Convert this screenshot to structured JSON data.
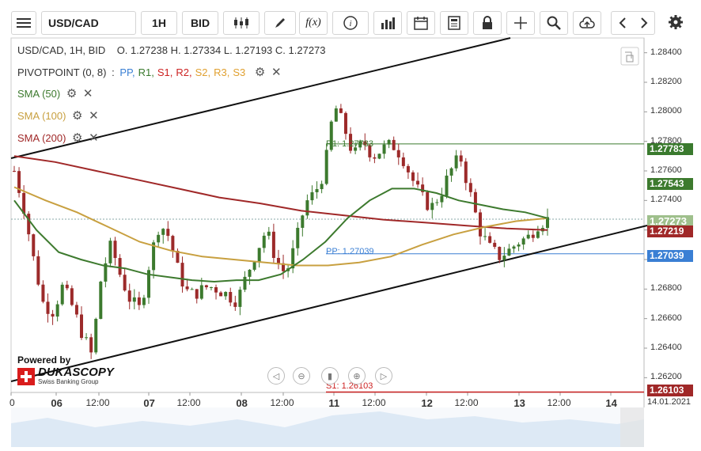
{
  "toolbar": {
    "menu_icon": "hamburger-icon",
    "symbol": "USD/CAD",
    "timeframe": "1H",
    "price_type": "BID",
    "fx_label": "f(x)",
    "info_label": "i"
  },
  "header": {
    "ohlc": "USD/CAD, 1H, BID    O. 1.27238 H. 1.27334 L. 1.27193 C. 1.27273"
  },
  "legend": {
    "pivot": {
      "name": "PIVOTPOINT (0, 8)",
      "sep": ":",
      "items": [
        "PP,",
        "R1,",
        "S1,",
        "R2,",
        "S2,",
        "R3,",
        "S3"
      ]
    },
    "sma50": "SMA (50)",
    "sma100": "SMA (100)",
    "sma200": "SMA (200)"
  },
  "colors": {
    "up": "#3c7a2e",
    "down": "#9c2a2a",
    "sma50": "#3d7a2e",
    "sma100": "#c8a040",
    "sma200": "#a02828",
    "pp": "#3a7fd4",
    "r1": "#3a7a2e",
    "s1": "#c22",
    "r2": "#c22",
    "s2": "#e0a030",
    "r3": "#e0a030",
    "s3": "#e0a030"
  },
  "price_tags": {
    "r1": "1.27783",
    "sma50": "1.27543",
    "last": "1.27273",
    "sma200": "1.27219",
    "pp": "1.27039",
    "s1": "1.26103"
  },
  "level_labels": {
    "r1": "R1: 1.27783",
    "pp": "PP: 1.27039",
    "s1": "S1: 1.26103"
  },
  "branding": {
    "powered": "Powered by",
    "name": "DUKASCOPY",
    "tagline": "Swiss Banking Group"
  },
  "chart_data": {
    "type": "candlestick",
    "symbol": "USD/CAD",
    "timeframe": "1H",
    "ylim": [
      1.261,
      1.285
    ],
    "y_ticks": [
      "1.28400",
      "1.28200",
      "1.28000",
      "1.27800",
      "1.27600",
      "1.27400",
      "1.27200",
      "1.27000",
      "1.26800",
      "1.26600",
      "1.26400",
      "1.26200"
    ],
    "x_ticks": [
      "0",
      "06",
      "12:00",
      "07",
      "12:00",
      "08",
      "12:00",
      "11",
      "12:00",
      "12",
      "12:00",
      "13",
      "12:00",
      "14",
      "14.01.2021"
    ],
    "last_ohlc": {
      "open": 1.27238,
      "high": 1.27334,
      "low": 1.27193,
      "close": 1.27273
    },
    "levels": {
      "R1": 1.27783,
      "PP": 1.27039,
      "S1": 1.26103
    },
    "sma_last": {
      "SMA50": 1.27543,
      "SMA100": 1.2728,
      "SMA200": 1.27219
    },
    "close_path": [
      1.276,
      1.2735,
      1.27,
      1.267,
      1.2665,
      1.2682,
      1.2668,
      1.265,
      1.2635,
      1.269,
      1.271,
      1.2688,
      1.2672,
      1.2666,
      1.27,
      1.2725,
      1.2715,
      1.269,
      1.2676,
      1.2678,
      1.2682,
      1.268,
      1.2676,
      1.2672,
      1.269,
      1.2706,
      1.272,
      1.27,
      1.269,
      1.271,
      1.2738,
      1.2745,
      1.276,
      1.2805,
      1.279,
      1.277,
      1.278,
      1.277,
      1.2775,
      1.2778,
      1.277,
      1.2755,
      1.2742,
      1.2735,
      1.2745,
      1.276,
      1.277,
      1.2745,
      1.272,
      1.2708,
      1.2702,
      1.2706,
      1.2712,
      1.2715,
      1.2724,
      1.2727
    ],
    "sma50": [
      1.274,
      1.272,
      1.2705,
      1.27,
      1.2696,
      1.2694,
      1.269,
      1.2688,
      1.2686,
      1.2685,
      1.2686,
      1.2686,
      1.269,
      1.27,
      1.2712,
      1.2728,
      1.274,
      1.2748,
      1.2748,
      1.2745,
      1.274,
      1.2737,
      1.2734,
      1.2732,
      1.2728
    ],
    "sma100": [
      1.2749,
      1.274,
      1.2732,
      1.2722,
      1.2712,
      1.2706,
      1.2702,
      1.27,
      1.2698,
      1.2696,
      1.2696,
      1.2698,
      1.2702,
      1.271,
      1.2717,
      1.2722,
      1.2726,
      1.2728
    ],
    "sma200": [
      1.277,
      1.2766,
      1.276,
      1.2754,
      1.2748,
      1.2742,
      1.2738,
      1.2733,
      1.273,
      1.2727,
      1.2725,
      1.2723,
      1.2721,
      1.272
    ]
  }
}
